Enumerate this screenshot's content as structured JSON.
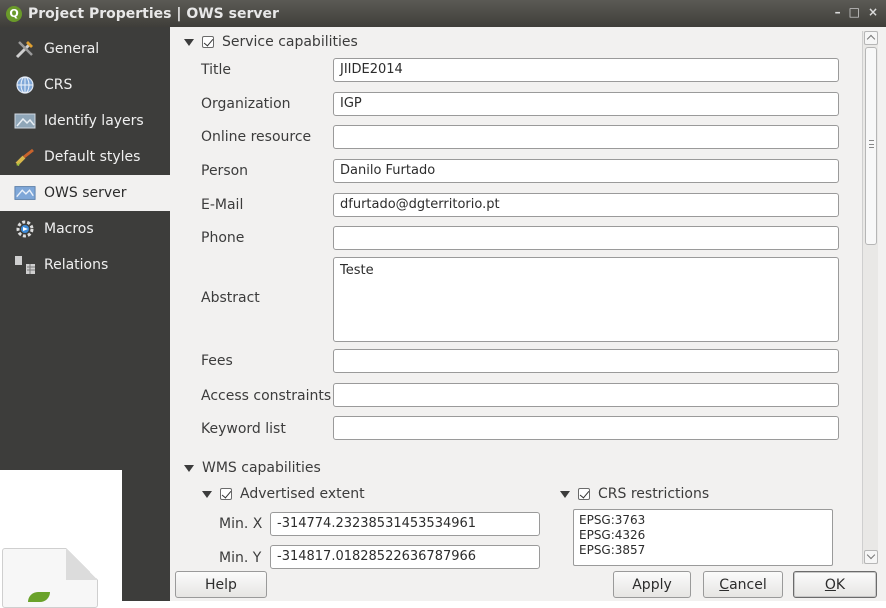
{
  "window": {
    "title": "Project Properties | OWS server",
    "controls": [
      "–",
      "□",
      "×"
    ]
  },
  "sidebar": {
    "items": [
      {
        "label": "General",
        "icon": "tools-icon",
        "active": false
      },
      {
        "label": "CRS",
        "icon": "globe-icon",
        "active": false
      },
      {
        "label": "Identify layers",
        "icon": "identify-icon",
        "active": false
      },
      {
        "label": "Default styles",
        "icon": "brush-icon",
        "active": false
      },
      {
        "label": "OWS server",
        "icon": "ows-icon",
        "active": true
      },
      {
        "label": "Macros",
        "icon": "gear-icon",
        "active": false
      },
      {
        "label": "Relations",
        "icon": "relations-icon",
        "active": false
      }
    ]
  },
  "service_capabilities": {
    "heading": "Service capabilities",
    "checked": true,
    "fields": {
      "title": {
        "label": "Title",
        "value": "JIIDE2014"
      },
      "organization": {
        "label": "Organization",
        "value": "IGP"
      },
      "online_resource": {
        "label": "Online resource",
        "value": ""
      },
      "person": {
        "label": "Person",
        "value": "Danilo Furtado"
      },
      "email": {
        "label": "E-Mail",
        "value": "dfurtado@dgterritorio.pt"
      },
      "phone": {
        "label": "Phone",
        "value": ""
      },
      "abstract": {
        "label": "Abstract",
        "value": "Teste"
      },
      "fees": {
        "label": "Fees",
        "value": ""
      },
      "access_constraints": {
        "label": "Access constraints",
        "value": ""
      },
      "keyword_list": {
        "label": "Keyword list",
        "value": ""
      }
    }
  },
  "wms_capabilities": {
    "heading": "WMS capabilities",
    "advertised_extent": {
      "heading": "Advertised extent",
      "checked": true,
      "min_x": {
        "label": "Min. X",
        "value": "-314774.23238531453534961"
      },
      "min_y": {
        "label": "Min. Y",
        "value": "-314817.01828522636787966"
      }
    },
    "crs_restrictions": {
      "heading": "CRS restrictions",
      "checked": true,
      "items": [
        "EPSG:3763",
        "EPSG:4326",
        "EPSG:3857"
      ]
    }
  },
  "buttons": {
    "help": "Help",
    "apply": "Apply",
    "cancel_prefix": "C",
    "cancel_rest": "ancel",
    "ok_prefix": "O",
    "ok_rest": "K"
  },
  "colors": {
    "sidebar_bg": "#3d3d3b",
    "panel_bg": "#f2f1f0",
    "titlebar_bg": "#4a4945"
  }
}
